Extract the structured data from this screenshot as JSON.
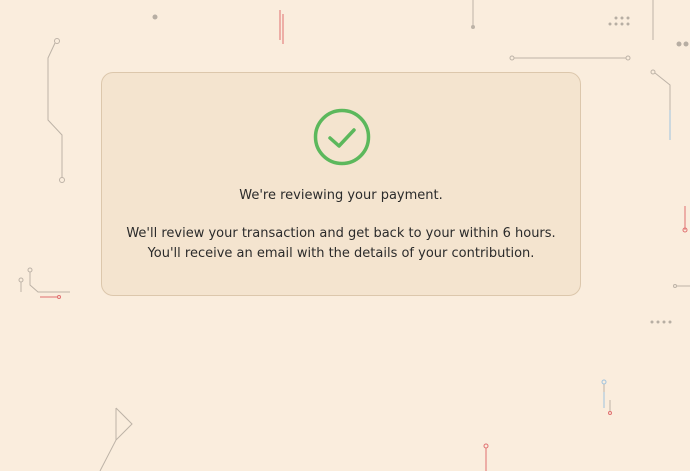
{
  "confirmation": {
    "icon": "check-circle-icon",
    "heading": "We're reviewing your payment.",
    "message_line1": "We'll review your transaction and get back to your within 6 hours.",
    "message_line2": "You'll receive an email with the details of your contribution."
  },
  "colors": {
    "page_background": "#faeddd",
    "card_background": "#f4e4cf",
    "card_border": "#dcc7ac",
    "success_green": "#5cb85c",
    "text": "#2b2b2b",
    "decor_gray": "#b7aea3",
    "decor_red": "#e07070",
    "decor_blue": "#a8c8e0"
  }
}
